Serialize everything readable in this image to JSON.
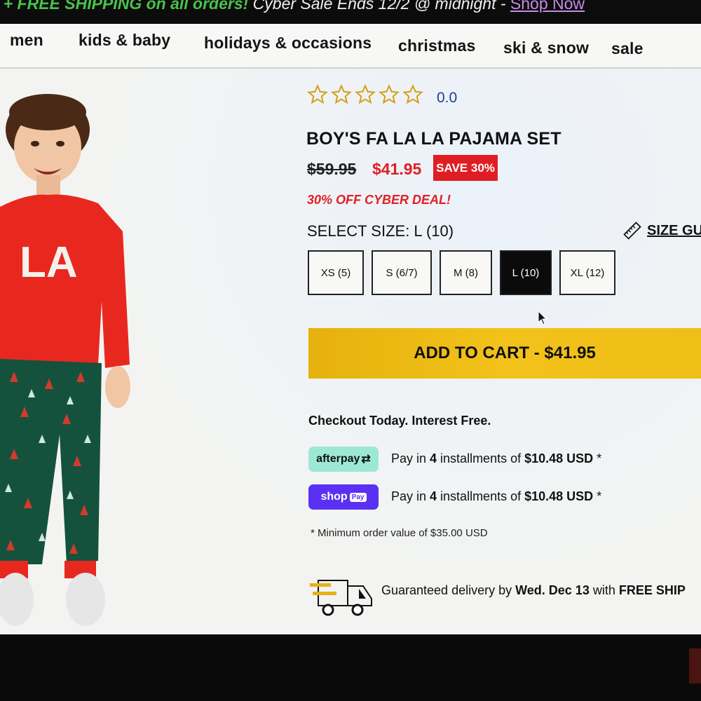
{
  "promo": {
    "lead": "IDE + FREE SHIPPING on all orders!",
    "sale_text": "Cyber Sale Ends 12/2 @ midnight -",
    "link": "Shop Now"
  },
  "nav": {
    "items": [
      "men",
      "kids & baby",
      "holidays & occasions",
      "christmas",
      "ski & snow",
      "sale"
    ]
  },
  "product": {
    "rating": "0.0",
    "stars_filled": 0,
    "stars_total": 5,
    "title": "BOY'S FA LA LA PAJAMA SET",
    "old_price": "$59.95",
    "new_price": "$41.95",
    "save_badge": "SAVE 30%",
    "deal": "30% OFF CYBER DEAL!",
    "select_size": "SELECT SIZE: L (10)",
    "size_guide": "SIZE GU",
    "sizes": [
      "XS (5)",
      "S (6/7)",
      "M (8)",
      "L (10)",
      "XL (12)"
    ],
    "selected_size": "L (10)",
    "add_to_cart": "ADD TO CART - $41.95",
    "shirt_print": "LA"
  },
  "payment": {
    "heading": "Checkout Today. Interest Free.",
    "afterpay_logo": "afterpay",
    "shoppay_logo": "shop",
    "shoppay_tag": "Pay",
    "afterpay_text_pre": "Pay in ",
    "afterpay_count": "4",
    "afterpay_text_mid": " installments of ",
    "afterpay_amount": "$10.48 USD",
    "afterpay_star": " *",
    "shoppay_text_pre": "Pay in ",
    "shoppay_count": "4",
    "shoppay_text_mid": " installments of ",
    "shoppay_amount": "$10.48 USD",
    "shoppay_star": " *",
    "min_order": "* Minimum order value of $35.00 USD"
  },
  "delivery": {
    "pre": "Guaranteed delivery by ",
    "date": "Wed. Dec 13",
    "mid": " with ",
    "ship": "FREE SHIP"
  },
  "colors": {
    "accent_red": "#e01f26",
    "cart_yellow": "#f2c21a",
    "star_gold": "#d4a017",
    "afterpay_mint": "#9de8d5",
    "shoppay_purple": "#5a31f4"
  }
}
